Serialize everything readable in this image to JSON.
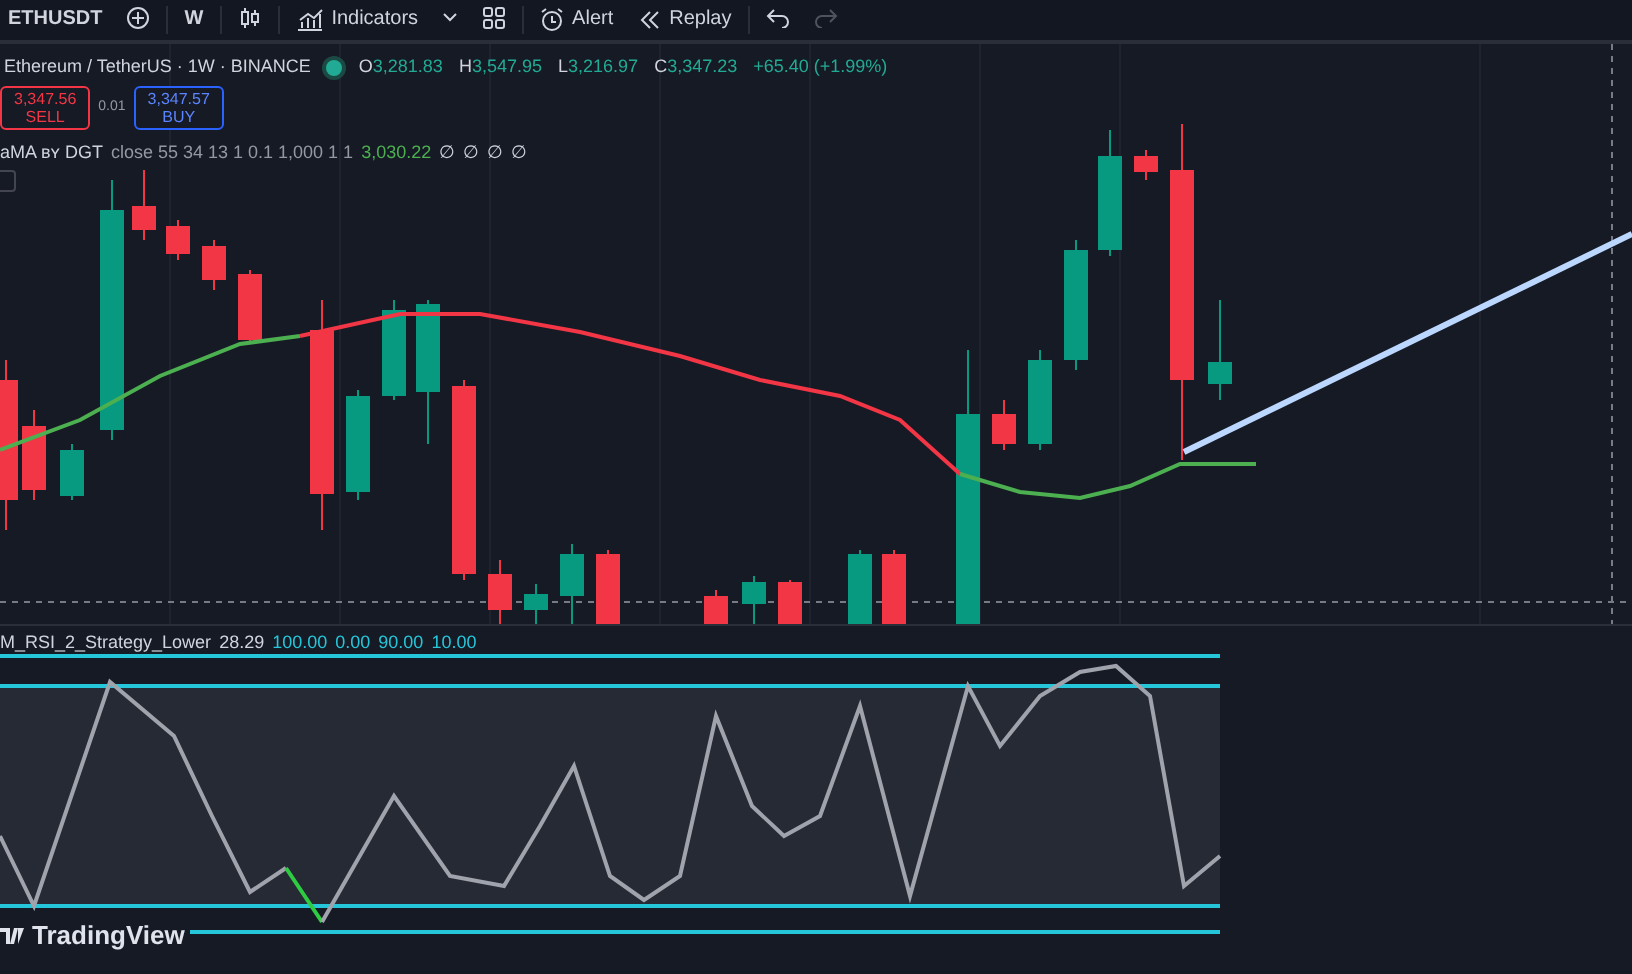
{
  "toolbar": {
    "symbol": "ETHUSDT",
    "interval": "W",
    "indicators": "Indicators",
    "alert": "Alert",
    "replay": "Replay"
  },
  "legend": {
    "title": "Ethereum / TetherUS · 1W · BINANCE",
    "market_open": true,
    "ohlc": [
      {
        "label": "O",
        "value": "3,281.83"
      },
      {
        "label": "H",
        "value": "3,547.95"
      },
      {
        "label": "L",
        "value": "3,216.97"
      },
      {
        "label": "C",
        "value": "3,347.23"
      }
    ],
    "change": "+65.40 (+1.99%)"
  },
  "trade": {
    "sell_price": "3,347.56",
    "sell_label": "SELL",
    "spread": "0.01",
    "buy_price": "3,347.57",
    "buy_label": "BUY"
  },
  "indicator": {
    "name": "aMA ʙʏ DGT",
    "params": "close 55 34 13 1 0.1 1,000 1 1",
    "value": "3,030.22",
    "empty_values": [
      "∅",
      "∅",
      "∅",
      "∅"
    ]
  },
  "rsi_pane": {
    "name": "M_RSI_2_Strategy_Lower",
    "value": "28.29",
    "levels": [
      "100.00",
      "0.00",
      "90.00",
      "10.00"
    ]
  },
  "logo": "TradingView"
}
